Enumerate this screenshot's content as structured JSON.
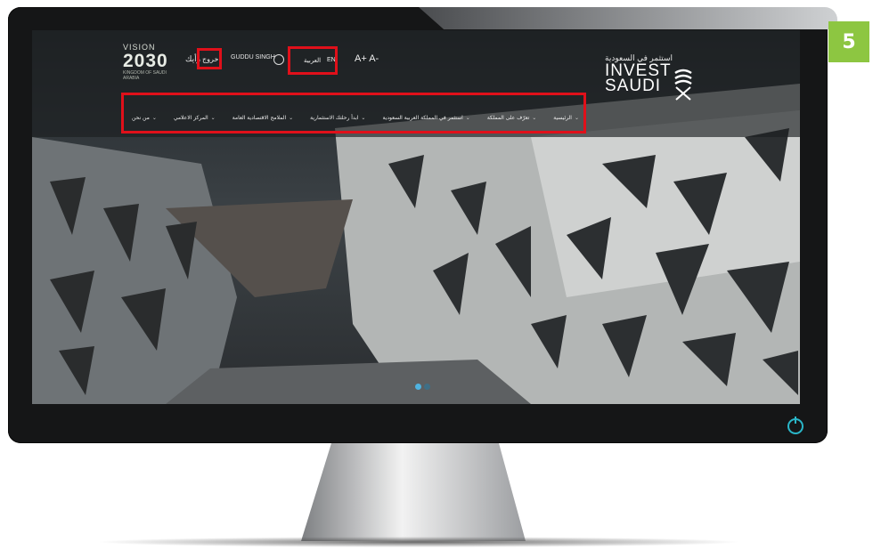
{
  "step_badge": "5",
  "header": {
    "vision_logo": {
      "line1": "VISION",
      "year": "2030",
      "subtitle": "KINGDOM OF SAUDI ARABIA"
    },
    "logout_label": "خروج",
    "feedback_label": "رأيك",
    "user_name": "GUDDU SINGH",
    "lang_ar": "العربية",
    "lang_en": "EN",
    "font_increase": "A+",
    "font_decrease": "A-",
    "brand": {
      "arabic": "استثمر في السعودية",
      "line1": "INVEST",
      "line2": "SAUDI"
    }
  },
  "nav": {
    "items": [
      {
        "label": "الرئيسية"
      },
      {
        "label": "تعرّف على المملكة"
      },
      {
        "label": "استثمر في المملكة العربية السعودية"
      },
      {
        "label": "ابدأ رحلتك الاستثمارية"
      },
      {
        "label": "الملامح الاقتصادية العامة"
      },
      {
        "label": "المركز الاعلامي"
      },
      {
        "label": "من نحن"
      }
    ]
  },
  "carousel": {
    "slides": 2,
    "active_index": 0
  },
  "colors": {
    "highlight": "#e0101a",
    "badge": "#8dc641",
    "power": "#2ab7c9"
  }
}
